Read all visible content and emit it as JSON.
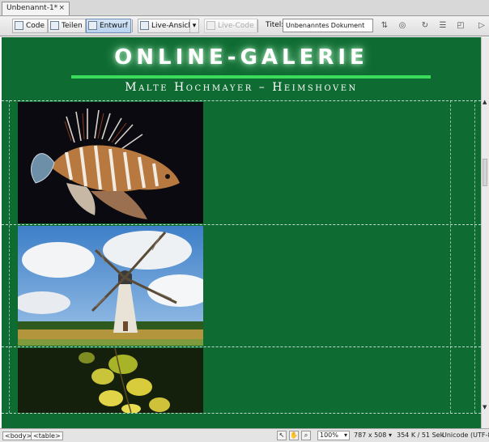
{
  "document_tab": {
    "label": "Unbenannt-1*",
    "close": "×"
  },
  "toolbar": {
    "code": "Code",
    "split": "Teilen",
    "design": "Entwurf",
    "live_view": "Live-Ansicht",
    "live_code": "Live-Code",
    "title_label": "Titel:",
    "title_value": "Unbenanntes Dokument"
  },
  "page": {
    "title": "ONLINE-GALERIE",
    "subtitle": "Malte Hochmayer – Heimshoven"
  },
  "gallery": [
    {
      "subject": "lionfish"
    },
    {
      "subject": "windmill"
    },
    {
      "subject": "yellow-leaves"
    }
  ],
  "status_bar": {
    "tags": [
      "<body>",
      "<table>"
    ],
    "zoom": "100%",
    "dimensions": "787 x 508",
    "size": "354 K / 51 Sek",
    "encoding": "Unicode (UTF-8)"
  },
  "colors": {
    "page_background": "#0e6b31",
    "title_rule": "#3bdc59"
  }
}
